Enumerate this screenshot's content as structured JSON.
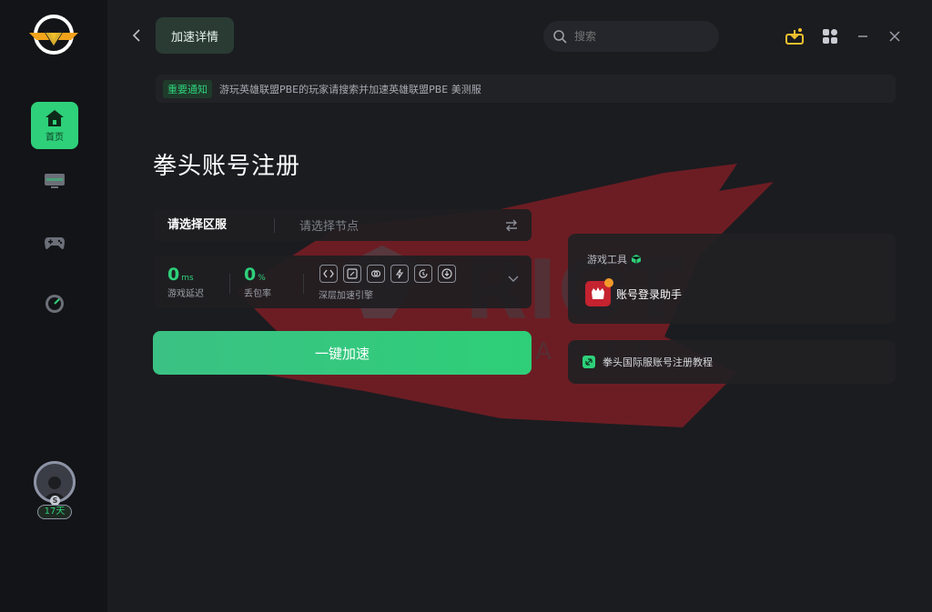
{
  "header": {
    "tab_label": "加速详情",
    "search_placeholder": "搜索"
  },
  "sidebar": {
    "home_label": "首页",
    "user": {
      "days_badge": "17天",
      "coin_symbol": "S"
    }
  },
  "notice": {
    "tag": "重要通知",
    "text": "游玩英雄联盟PBE的玩家请搜索并加速英雄联盟PBE 美测服"
  },
  "game": {
    "title": "拳头账号注册",
    "region_label": "请选择区服",
    "node_placeholder": "请选择节点",
    "latency": {
      "value": "0",
      "unit": "ms",
      "caption": "游戏延迟"
    },
    "packet_loss": {
      "value": "0",
      "unit": "%",
      "caption": "丢包率"
    },
    "engine_caption": "深层加速引擎",
    "boost_label": "一键加速"
  },
  "tools": {
    "header": "游戏工具",
    "item_label": "账号登录助手"
  },
  "guide": {
    "label": "拳头国际服账号注册教程"
  },
  "colors": {
    "accent": "#2ed07a",
    "bg": "#1b1c20",
    "sidebar": "#131417",
    "brand_red": "#c4232f",
    "gold": "#f2c12e"
  }
}
